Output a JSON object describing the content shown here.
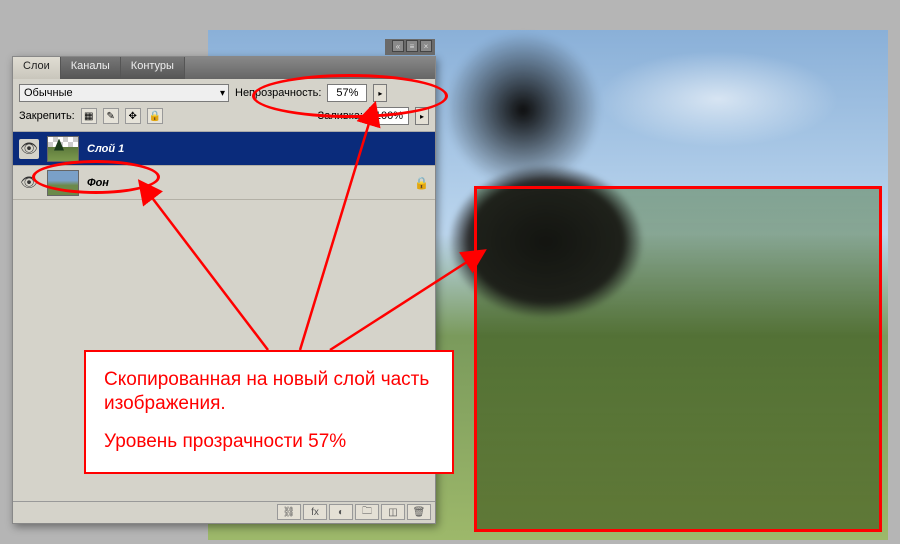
{
  "panel": {
    "tabs": {
      "layers": "Слои",
      "channels": "Каналы",
      "paths": "Контуры"
    },
    "blend_mode": "Обычные",
    "opacity_label": "Непрозрачность:",
    "opacity_value": "57%",
    "lock_label": "Закрепить:",
    "fill_label": "Заливка:",
    "fill_value": "100%"
  },
  "layers": [
    {
      "name": "Слой 1",
      "visible": true,
      "active": true,
      "locked": false
    },
    {
      "name": "Фон",
      "visible": true,
      "active": false,
      "locked": true
    }
  ],
  "icons": {
    "menu": "≡",
    "close": "×",
    "collapse": "«",
    "eye": "👁",
    "lock": "🔒",
    "lock_transparent": "▦",
    "brush": "✎",
    "move": "✥",
    "lock_all": "🔒",
    "arrow_right": "▸",
    "footer": {
      "link": "⛓",
      "fx": "fx",
      "mask": "◐",
      "folder": "🗀",
      "new": "◫",
      "trash": "🗑"
    }
  },
  "annotation": {
    "line1": "Скопированная на новый слой часть изображения.",
    "line2": "Уровень прозрачности 57%"
  },
  "colors": {
    "accent": "#ff0000",
    "selection": "#0a2b7b",
    "panel_bg": "#d5d3ca"
  }
}
